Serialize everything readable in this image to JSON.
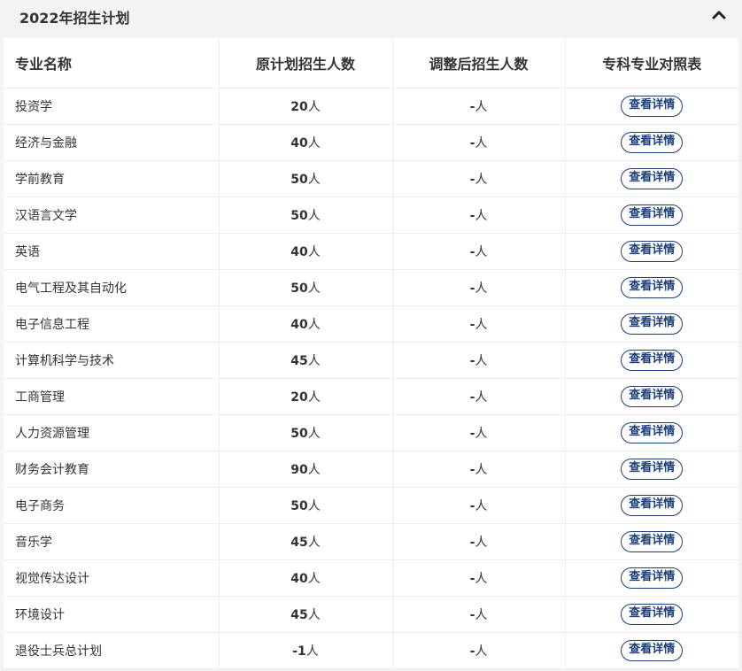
{
  "panel": {
    "title": "2022年招生计划"
  },
  "table": {
    "headers": [
      "专业名称",
      "原计划招生人数",
      "调整后招生人数",
      "专科专业对照表"
    ],
    "unit": "人",
    "detail_label": "查看详情",
    "rows": [
      {
        "major": "投资学",
        "planned": "20",
        "adjusted": "-"
      },
      {
        "major": "经济与金融",
        "planned": "40",
        "adjusted": "-"
      },
      {
        "major": "学前教育",
        "planned": "50",
        "adjusted": "-"
      },
      {
        "major": "汉语言文学",
        "planned": "50",
        "adjusted": "-"
      },
      {
        "major": "英语",
        "planned": "40",
        "adjusted": "-"
      },
      {
        "major": "电气工程及其自动化",
        "planned": "50",
        "adjusted": "-"
      },
      {
        "major": "电子信息工程",
        "planned": "40",
        "adjusted": "-"
      },
      {
        "major": "计算机科学与技术",
        "planned": "45",
        "adjusted": "-"
      },
      {
        "major": "工商管理",
        "planned": "20",
        "adjusted": "-"
      },
      {
        "major": "人力资源管理",
        "planned": "50",
        "adjusted": "-"
      },
      {
        "major": "财务会计教育",
        "planned": "90",
        "adjusted": "-"
      },
      {
        "major": "电子商务",
        "planned": "50",
        "adjusted": "-"
      },
      {
        "major": "音乐学",
        "planned": "45",
        "adjusted": "-"
      },
      {
        "major": "视觉传达设计",
        "planned": "40",
        "adjusted": "-"
      },
      {
        "major": "环境设计",
        "planned": "45",
        "adjusted": "-"
      },
      {
        "major": "退役士兵总计划",
        "planned": "-1",
        "adjusted": "-"
      }
    ]
  },
  "icons": {
    "collapse": "chevron-up-icon"
  }
}
